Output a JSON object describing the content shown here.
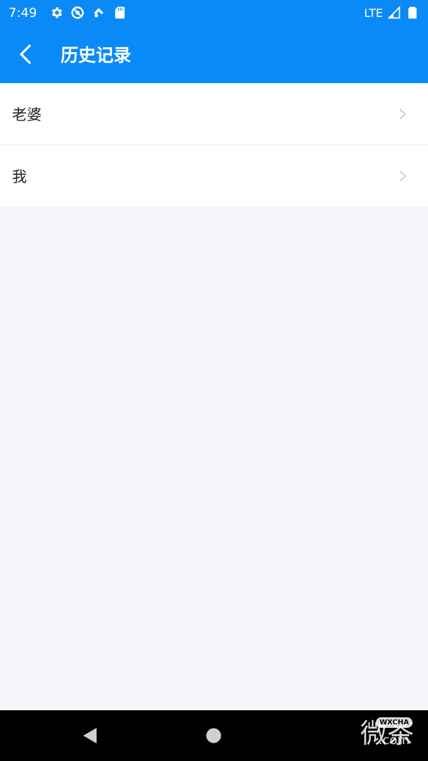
{
  "status_bar": {
    "time": "7:49",
    "network": "LTE",
    "icons": [
      "settings-icon",
      "do-not-disturb-icon",
      "wifi-calling-icon",
      "sd-card-icon",
      "signal-icon",
      "battery-icon"
    ]
  },
  "header": {
    "title": "历史记录",
    "back_icon": "chevron-left-icon"
  },
  "history": {
    "items": [
      {
        "label": "老婆"
      },
      {
        "label": "我"
      }
    ]
  },
  "watermark": {
    "text": "微茶",
    "badge": "WXCHA",
    "domain": ".com"
  },
  "colors": {
    "primary": "#0a8af7",
    "background": "#f4f6fa",
    "list_bg": "#ffffff",
    "text": "#222222",
    "chevron": "#c4c7cc"
  }
}
